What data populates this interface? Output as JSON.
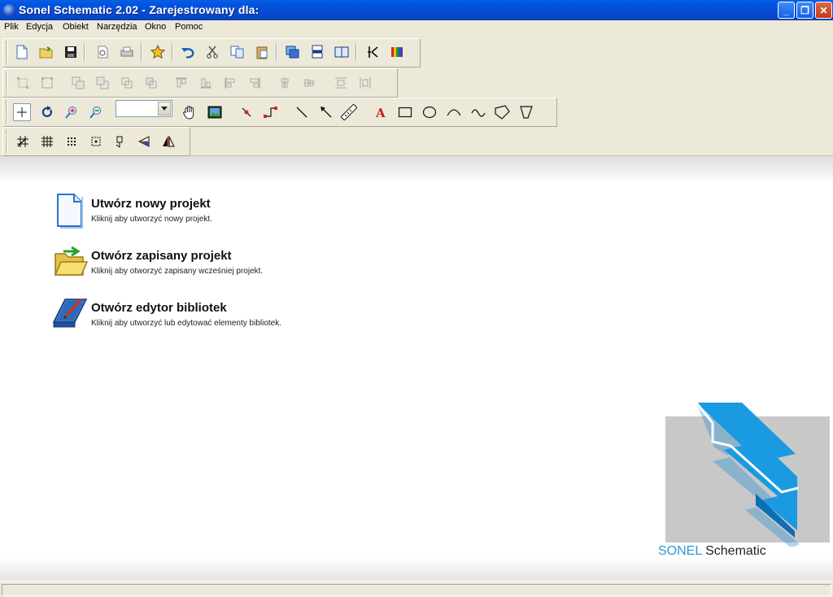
{
  "window": {
    "title": "Sonel Schematic 2.02 - Zarejestrowany dla:",
    "controls": {
      "minimize": "_",
      "maximize": "❐",
      "close": "✕"
    }
  },
  "menu": {
    "items": [
      "Plik",
      "Edycja",
      "Obiekt",
      "Narzędzia",
      "Okno",
      "Pomoc"
    ]
  },
  "toolbar_standard": {
    "icons": [
      "new-file-icon",
      "open-folder-icon",
      "save-icon",
      "print-preview-icon",
      "print-icon",
      "favorite-star-icon",
      "undo-icon",
      "cut-icon",
      "copy-icon",
      "paste-icon",
      "layers-icon",
      "arrange-icon",
      "book-icon",
      "capacitor-symbol-icon",
      "color-palette-icon"
    ]
  },
  "toolbar_align": {
    "icons": [
      "group-icon",
      "ungroup-icon",
      "bring-front-icon",
      "send-back-icon",
      "forward-icon",
      "backward-icon",
      "align-top-icon",
      "align-bottom-icon",
      "align-left-icon",
      "align-right-icon",
      "center-horizontal-icon",
      "center-vertical-icon",
      "distribute-horizontal-icon",
      "distribute-vertical-icon"
    ]
  },
  "toolbar_draw": {
    "zoom_value": "",
    "icons": [
      "select-crosshair-icon",
      "rotate-icon",
      "zoom-in-icon",
      "zoom-out-icon",
      "hand-pan-icon",
      "image-icon",
      "point-icon",
      "connector-icon",
      "line-icon",
      "arrow-line-icon",
      "measure-icon",
      "text-icon",
      "rectangle-icon",
      "ellipse-icon",
      "arc-icon",
      "wave-icon",
      "polygon-icon",
      "shape-icon"
    ]
  },
  "toolbar_grid": {
    "icons": [
      "grid-snap-icon",
      "grid-icon",
      "dots-grid-icon",
      "snap-point-icon",
      "pin-icon",
      "flip-vertical-icon",
      "flip-horizontal-icon"
    ]
  },
  "start_actions": [
    {
      "title": "Utwórz nowy projekt",
      "description": "Kliknij aby utworzyć nowy projekt."
    },
    {
      "title": "Otwórz zapisany projekt",
      "description": "Kliknij aby otworzyć zapisany wcześniej projekt."
    },
    {
      "title": "Otwórz edytor bibliotek",
      "description": "Kliknij aby utworzyć lub edytować elementy bibliotek."
    }
  ],
  "logo": {
    "brand": "SONEL",
    "product": "Schematic"
  },
  "colors": {
    "titlebar": "#0054e3",
    "logo_blue": "#1a9ae0",
    "logo_gray": "#c8c8c8",
    "chrome": "#ece9d8"
  },
  "status": {
    "text": ""
  }
}
